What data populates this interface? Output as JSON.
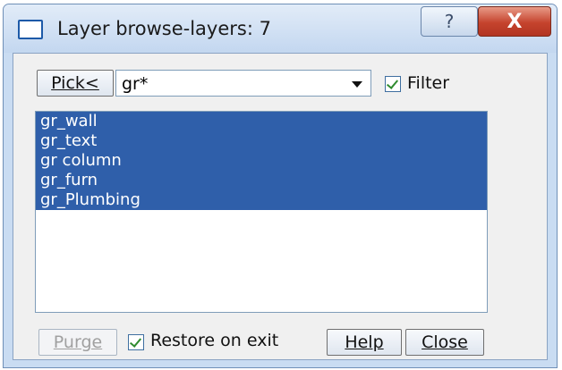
{
  "window": {
    "title": "Layer browse-layers: 7",
    "title_icon": "window-icon",
    "help_glyph": "?",
    "close_glyph": "X"
  },
  "toolbar": {
    "pick_label": "Pick<",
    "filter_value": "gr*",
    "filter_checked": true,
    "filter_label": "Filter"
  },
  "layers": [
    {
      "name": "gr_wall",
      "selected": true
    },
    {
      "name": "gr_text",
      "selected": true
    },
    {
      "name": "gr column",
      "selected": true
    },
    {
      "name": "gr_furn",
      "selected": true
    },
    {
      "name": "gr_Plumbing",
      "selected": true
    }
  ],
  "footer": {
    "purge_label": "Purge",
    "restore_checked": true,
    "restore_label": "Restore on exit",
    "help_label": "Help",
    "close_label": "Close"
  },
  "colors": {
    "selection": "#2f5faa",
    "title_close": "#c5432d",
    "checkmark": "#2f8b2f"
  }
}
